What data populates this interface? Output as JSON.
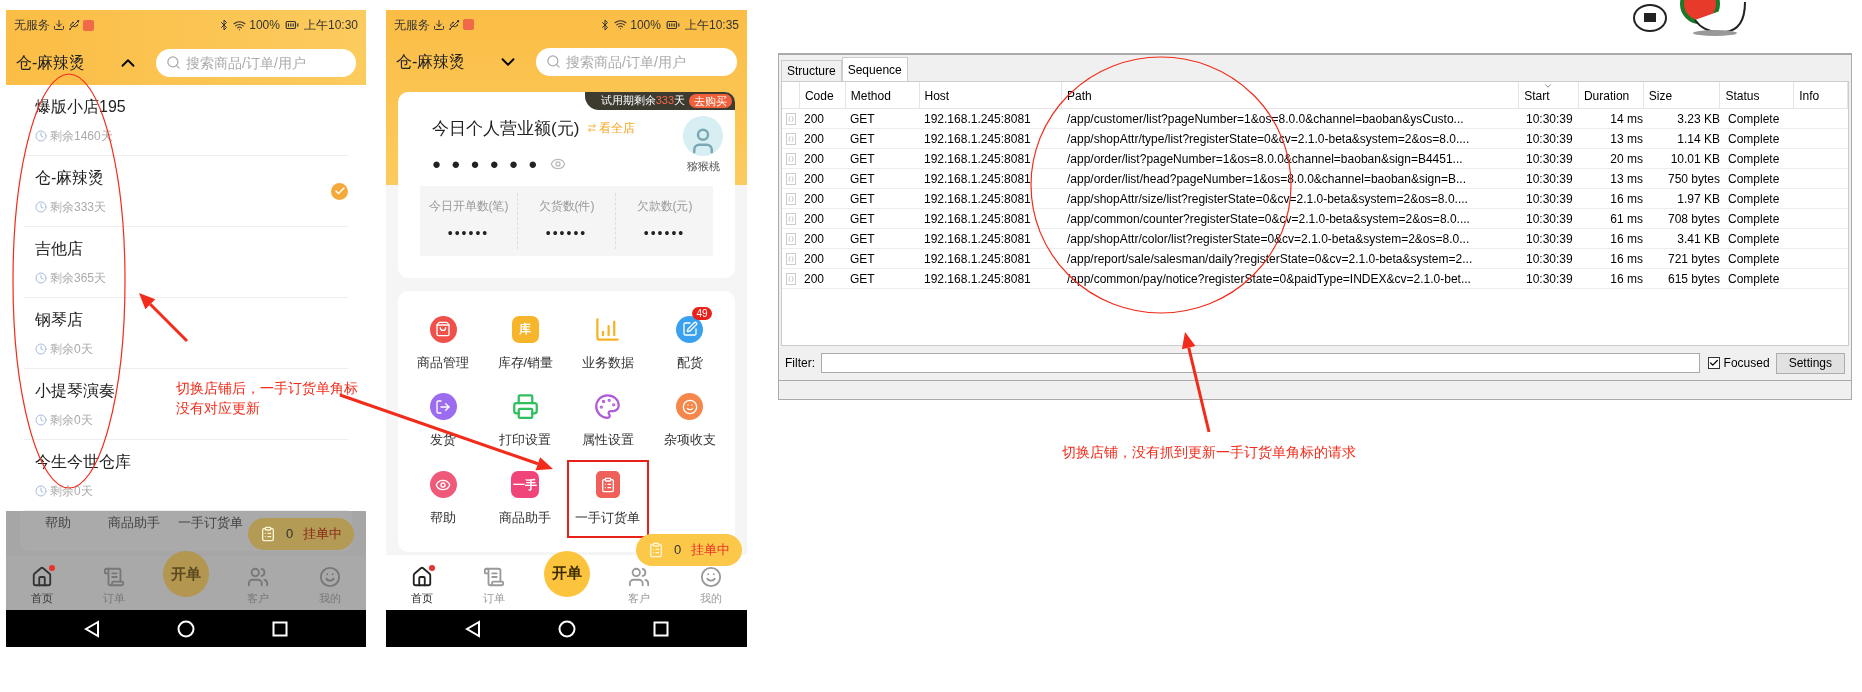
{
  "phone_store_switch": {
    "status_bar": {
      "carrier": "无服务",
      "battery": "100%",
      "time": "上午10:30"
    },
    "header": {
      "store": "仓-麻辣烫",
      "expanded": true,
      "search_placeholder": "搜索商品/订单/用户"
    },
    "stores": [
      {
        "name": "爆版小店195",
        "remaining": "剩余1460天",
        "selected": false
      },
      {
        "name": "仓-麻辣烫",
        "remaining": "剩余333天",
        "selected": true
      },
      {
        "name": "吉他店",
        "remaining": "剩余365天",
        "selected": false
      },
      {
        "name": "钢琴店",
        "remaining": "剩余0天",
        "selected": false
      },
      {
        "name": "小提琴演奏",
        "remaining": "剩余0天",
        "selected": false
      },
      {
        "name": "今生今世仓库",
        "remaining": "剩余0天",
        "selected": false
      }
    ],
    "dimmed_shortcuts": [
      "帮助",
      "商品助手",
      "一手订货单"
    ],
    "pending": {
      "count": "0",
      "label": "挂单中"
    },
    "nav": [
      {
        "label": "首页",
        "kind": "home",
        "selected": true,
        "dot": true
      },
      {
        "label": "订单",
        "kind": "orders",
        "selected": false,
        "dot": false
      },
      {
        "label": "开单",
        "kind": "create",
        "selected": false,
        "dot": false
      },
      {
        "label": "客户",
        "kind": "customers",
        "selected": false,
        "dot": false
      },
      {
        "label": "我的",
        "kind": "me",
        "selected": false,
        "dot": false
      }
    ]
  },
  "phone_home": {
    "status_bar": {
      "carrier": "无服务",
      "battery": "100%",
      "time": "上午10:35"
    },
    "header": {
      "store": "仓-麻辣烫",
      "expanded": false,
      "search_placeholder": "搜索商品/订单/用户"
    },
    "trial": {
      "prefix": "试用期剩余",
      "days": "333",
      "suffix": "天",
      "button": "去购买"
    },
    "revenue": {
      "title": "今日个人营业额(元)",
      "switch": "看全店",
      "value": "● ● ● ● ● ●"
    },
    "user": {
      "name": "猕猴桃"
    },
    "stats": [
      {
        "label": "今日开单数(笔)",
        "value": "••••••"
      },
      {
        "label": "欠货数(件)",
        "value": "••••••"
      },
      {
        "label": "欠款数(元)",
        "value": "••••••"
      }
    ],
    "shortcuts": [
      {
        "label": "商品管理",
        "kind": "goods",
        "color": "#f0504a",
        "highlighted": false
      },
      {
        "label": "库存/销量",
        "kind": "text",
        "icon_text": "库",
        "color": "#f7b52c",
        "highlighted": false
      },
      {
        "label": "业务数据",
        "kind": "chart",
        "color": "#f5b323",
        "highlighted": false
      },
      {
        "label": "配货",
        "kind": "dispatch",
        "color": "#3aa0f0",
        "badge": "49",
        "highlighted": false
      },
      {
        "label": "发货",
        "kind": "ship",
        "color": "#9b6cf0",
        "highlighted": false
      },
      {
        "label": "打印设置",
        "kind": "print",
        "color": "#2fbf5f",
        "highlighted": false
      },
      {
        "label": "属性设置",
        "kind": "palette",
        "color": "#b05ad8",
        "highlighted": false
      },
      {
        "label": "杂项收支",
        "kind": "misc",
        "color": "#f5874a",
        "highlighted": false
      },
      {
        "label": "帮助",
        "kind": "eye",
        "color": "#f05a7a",
        "highlighted": false
      },
      {
        "label": "商品助手",
        "kind": "text",
        "icon_text": "一手",
        "color": "#f0457a",
        "highlighted": false
      },
      {
        "label": "一手订货单",
        "kind": "clipboard",
        "color": "#f0605a",
        "highlighted": true
      }
    ],
    "pending": {
      "count": "0",
      "label": "挂单中"
    },
    "nav": [
      {
        "label": "首页",
        "kind": "home",
        "selected": true,
        "dot": true
      },
      {
        "label": "订单",
        "kind": "orders",
        "selected": false,
        "dot": false
      },
      {
        "label": "开单",
        "kind": "create",
        "selected": false,
        "dot": false
      },
      {
        "label": "客户",
        "kind": "customers",
        "selected": false,
        "dot": false
      },
      {
        "label": "我的",
        "kind": "me",
        "selected": false,
        "dot": false
      }
    ]
  },
  "proxy": {
    "tabs": [
      {
        "label": "Structure",
        "selected": false
      },
      {
        "label": "Sequence",
        "selected": true
      }
    ],
    "columns": [
      {
        "label": "Code",
        "sorted": false
      },
      {
        "label": "Method",
        "sorted": false
      },
      {
        "label": "Host",
        "sorted": false
      },
      {
        "label": "Path",
        "sorted": false
      },
      {
        "label": "Start",
        "sorted": true
      },
      {
        "label": "Duration",
        "sorted": false
      },
      {
        "label": "Size",
        "sorted": false
      },
      {
        "label": "Status",
        "sorted": false
      },
      {
        "label": "Info",
        "sorted": false
      }
    ],
    "rows": [
      {
        "code": "200",
        "method": "GET",
        "host": "192.168.1.245:8081",
        "path": "/app/customer/list?pageNumber=1&os=8.0.0&channel=baoban&ysCusto...",
        "start": "10:30:39",
        "duration": "14 ms",
        "size": "3.23 KB",
        "status": "Complete"
      },
      {
        "code": "200",
        "method": "GET",
        "host": "192.168.1.245:8081",
        "path": "/app/shopAttr/type/list?registerState=0&cv=2.1.0-beta&system=2&os=8.0....",
        "start": "10:30:39",
        "duration": "13 ms",
        "size": "1.14 KB",
        "status": "Complete"
      },
      {
        "code": "200",
        "method": "GET",
        "host": "192.168.1.245:8081",
        "path": "/app/order/list?pageNumber=1&os=8.0.0&channel=baoban&sign=B4451...",
        "start": "10:30:39",
        "duration": "20 ms",
        "size": "10.01 KB",
        "status": "Complete"
      },
      {
        "code": "200",
        "method": "GET",
        "host": "192.168.1.245:8081",
        "path": "/app/order/list/head?pageNumber=1&os=8.0.0&channel=baoban&sign=B...",
        "start": "10:30:39",
        "duration": "13 ms",
        "size": "750 bytes",
        "status": "Complete"
      },
      {
        "code": "200",
        "method": "GET",
        "host": "192.168.1.245:8081",
        "path": "/app/shopAttr/size/list?registerState=0&cv=2.1.0-beta&system=2&os=8.0....",
        "start": "10:30:39",
        "duration": "16 ms",
        "size": "1.97 KB",
        "status": "Complete"
      },
      {
        "code": "200",
        "method": "GET",
        "host": "192.168.1.245:8081",
        "path": "/app/common/counter?registerState=0&cv=2.1.0-beta&system=2&os=8.0....",
        "start": "10:30:39",
        "duration": "61 ms",
        "size": "708 bytes",
        "status": "Complete"
      },
      {
        "code": "200",
        "method": "GET",
        "host": "192.168.1.245:8081",
        "path": "/app/shopAttr/color/list?registerState=0&cv=2.1.0-beta&system=2&os=8.0...",
        "start": "10:30:39",
        "duration": "16 ms",
        "size": "3.41 KB",
        "status": "Complete"
      },
      {
        "code": "200",
        "method": "GET",
        "host": "192.168.1.245:8081",
        "path": "/app/report/sale/salesman/daily?registerState=0&cv=2.1.0-beta&system=2...",
        "start": "10:30:39",
        "duration": "16 ms",
        "size": "721 bytes",
        "status": "Complete"
      },
      {
        "code": "200",
        "method": "GET",
        "host": "192.168.1.245:8081",
        "path": "/app/common/pay/notice?registerState=0&paidType=INDEX&cv=2.1.0-bet...",
        "start": "10:30:39",
        "duration": "16 ms",
        "size": "615 bytes",
        "status": "Complete"
      }
    ],
    "filter": {
      "label": "Filter:"
    },
    "focused": {
      "label": "Focused",
      "checked": true
    },
    "settings_button": "Settings"
  },
  "annotations": [
    {
      "lines": [
        "切换店铺后，一手订货单角标",
        "没有对应更新"
      ]
    },
    {
      "lines": [
        "切换店铺，没有抓到更新一手订货单角标的请求"
      ]
    }
  ]
}
